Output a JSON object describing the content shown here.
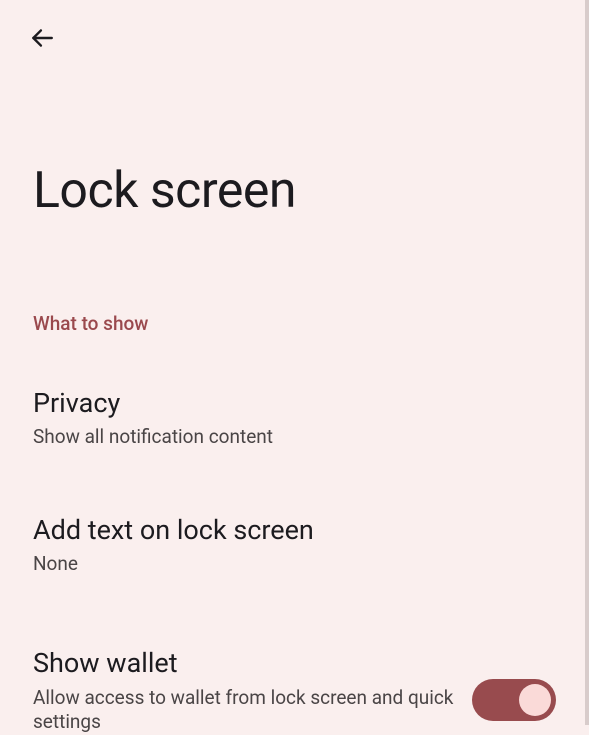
{
  "page": {
    "title": "Lock screen"
  },
  "section": {
    "header": "What to show"
  },
  "settings": {
    "privacy": {
      "title": "Privacy",
      "subtitle": "Show all notification content"
    },
    "add_text": {
      "title": "Add text on lock screen",
      "subtitle": "None"
    },
    "show_wallet": {
      "title": "Show wallet",
      "subtitle": "Allow access to wallet from lock screen and quick settings",
      "enabled": true
    }
  }
}
